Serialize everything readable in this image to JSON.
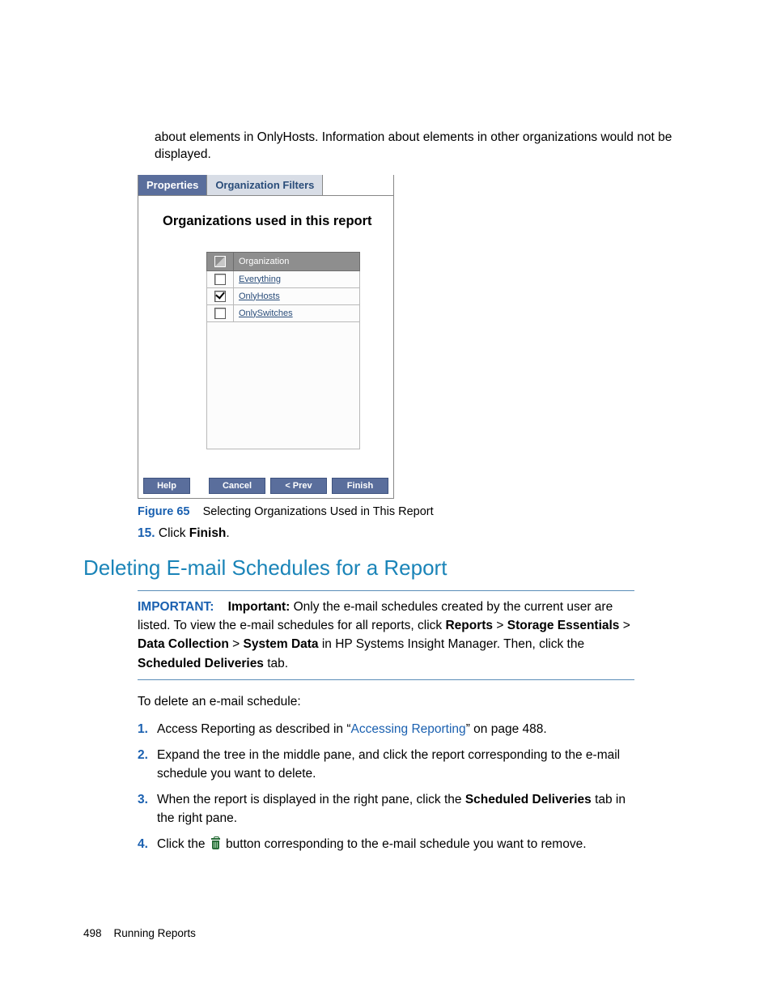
{
  "intro_paragraph": "about elements in OnlyHosts. Information about elements in other organizations would not be displayed.",
  "dialog": {
    "tabs": {
      "properties": "Properties",
      "org_filters": "Organization Filters"
    },
    "heading": "Organizations used in this report",
    "col_header": "Organization",
    "rows": [
      {
        "label": "Everything",
        "checked": false
      },
      {
        "label": "OnlyHosts",
        "checked": true
      },
      {
        "label": "OnlySwitches",
        "checked": false
      }
    ],
    "buttons": {
      "help": "Help",
      "cancel": "Cancel",
      "prev": "< Prev",
      "finish": "Finish"
    }
  },
  "figure": {
    "label": "Figure 65",
    "caption": "Selecting Organizations Used in This Report"
  },
  "step15": {
    "num": "15.",
    "pre": "Click ",
    "bold": "Finish",
    "post": "."
  },
  "section_heading": "Deleting E-mail Schedules for a Report",
  "important": {
    "label": "IMPORTANT:",
    "lead": "Important:",
    "t1": " Only the e-mail schedules created by the current user are listed. To view the e-mail schedules for all reports, click ",
    "b1": "Reports",
    "gt": " > ",
    "b2": "Storage Essentials",
    "b3": "Data Collection",
    "b4": "System Data",
    "t2": " in HP Systems Insight Manager. Then, click the ",
    "b5": "Scheduled Deliveries",
    "t3": " tab."
  },
  "intro2": "To delete an e-mail schedule:",
  "steps": {
    "n1": "1.",
    "n2": "2.",
    "n3": "3.",
    "n4": "4.",
    "s1a": "Access Reporting as described in “",
    "s1link": "Accessing Reporting",
    "s1b": "” on page 488.",
    "s2": "Expand the tree in the middle pane, and click the report corresponding to the e-mail schedule you want to delete.",
    "s3a": "When the report is displayed in the right pane, click the ",
    "s3b": "Scheduled Deliveries",
    "s3c": " tab in the right pane.",
    "s4a": "Click the ",
    "s4b": " button corresponding to the e-mail schedule you want to remove."
  },
  "footer": {
    "page": "498",
    "title": "Running Reports"
  }
}
